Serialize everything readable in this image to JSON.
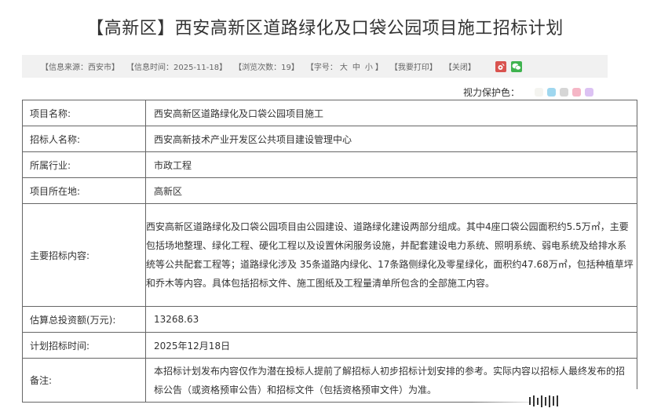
{
  "page_title": "【高新区】西安高新区道路绿化及口袋公园项目施工招标计划",
  "infobar": {
    "source": "【信息来源：西安市】",
    "time": "【信息时间：2025-11-18】",
    "views": "【浏览次数：19】",
    "font_prefix": "【字号：",
    "font_large": "大",
    "font_medium": "中",
    "font_small": "小",
    "font_suffix": "】",
    "print": "【我要打印】",
    "close": "【关闭】"
  },
  "eye_protection": {
    "label": "视力保护色：",
    "colors": [
      "#f4f4f0",
      "#9fd7ef",
      "#d6d6d6",
      "#f5b6c6",
      "#dcc2f3"
    ]
  },
  "table": [
    {
      "key": "项目名称:",
      "value": "西安高新区道路绿化及口袋公园项目施工"
    },
    {
      "key": "招标人名称:",
      "value": "西安高新技术产业开发区公共项目建设管理中心"
    },
    {
      "key": "所属行业:",
      "value": "市政工程"
    },
    {
      "key": "项目所在地:",
      "value": "高新区"
    },
    {
      "key": "主要招标内容:",
      "value": "西安高新区道路绿化及口袋公园项目由公园建设、道路绿化建设两部分组成。其中4座口袋公园面积约5.5万㎡，主要包括场地整理、绿化工程、硬化工程以及设置休闲服务设施，并配套建设电力系统、照明系统、弱电系统及给排水系统等公共配套工程等；道路绿化涉及 35条道路内绿化、17条路侧绿化及零星绿化，面积约47.68万㎡，包括种植草坪和乔木等内容。具体包括招标文件、施工图纸及工程量清单所包含的全部施工内容。"
    },
    {
      "key": "估算总投资额(万元):",
      "value": "13268.63"
    },
    {
      "key": "计划招标时间:",
      "value": "2025年12月18日"
    },
    {
      "key": "备注:",
      "value": "本招标计划发布内容仅作为潜在投标人提前了解招标人初步招标计划安排的参考。实际内容以招标人最终发布的招标公告（或资格预审公告）和招标文件（包括资格预审文件）为准。"
    }
  ]
}
